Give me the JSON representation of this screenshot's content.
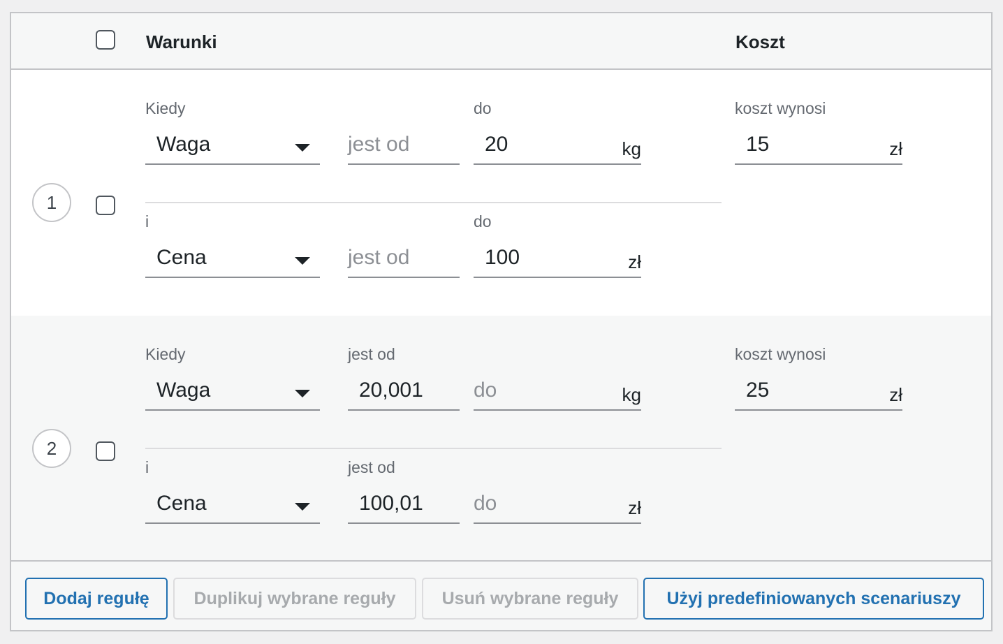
{
  "header": {
    "conditions_label": "Warunki",
    "cost_label": "Koszt"
  },
  "rules": [
    {
      "number": "1",
      "conditions": [
        {
          "label_left": "Kiedy",
          "label_mid": "",
          "label_right": "do",
          "select": "Waga",
          "from_value": "",
          "from_placeholder": "jest od",
          "to_value": "20",
          "to_placeholder": "",
          "unit": "kg"
        },
        {
          "label_left": "i",
          "label_mid": "",
          "label_right": "do",
          "select": "Cena",
          "from_value": "",
          "from_placeholder": "jest od",
          "to_value": "100",
          "to_placeholder": "",
          "unit": "zł"
        }
      ],
      "cost_label": "koszt wynosi",
      "cost_value": "15",
      "cost_unit": "zł"
    },
    {
      "number": "2",
      "conditions": [
        {
          "label_left": "Kiedy",
          "label_mid": "jest od",
          "label_right": "",
          "select": "Waga",
          "from_value": "20,001",
          "from_placeholder": "",
          "to_value": "",
          "to_placeholder": "do",
          "unit": "kg"
        },
        {
          "label_left": "i",
          "label_mid": "jest od",
          "label_right": "",
          "select": "Cena",
          "from_value": "100,01",
          "from_placeholder": "",
          "to_value": "",
          "to_placeholder": "do",
          "unit": "zł"
        }
      ],
      "cost_label": "koszt wynosi",
      "cost_value": "25",
      "cost_unit": "zł"
    }
  ],
  "buttons": {
    "add_rule": "Dodaj regułę",
    "duplicate_selected": "Duplikuj wybrane reguły",
    "delete_selected": "Usuń wybrane reguły",
    "use_predefined": "Użyj predefiniowanych scenariuszy"
  },
  "colors": {
    "accent": "#2271b1",
    "disabled": "#a7aaad",
    "border": "#c3c4c7"
  }
}
